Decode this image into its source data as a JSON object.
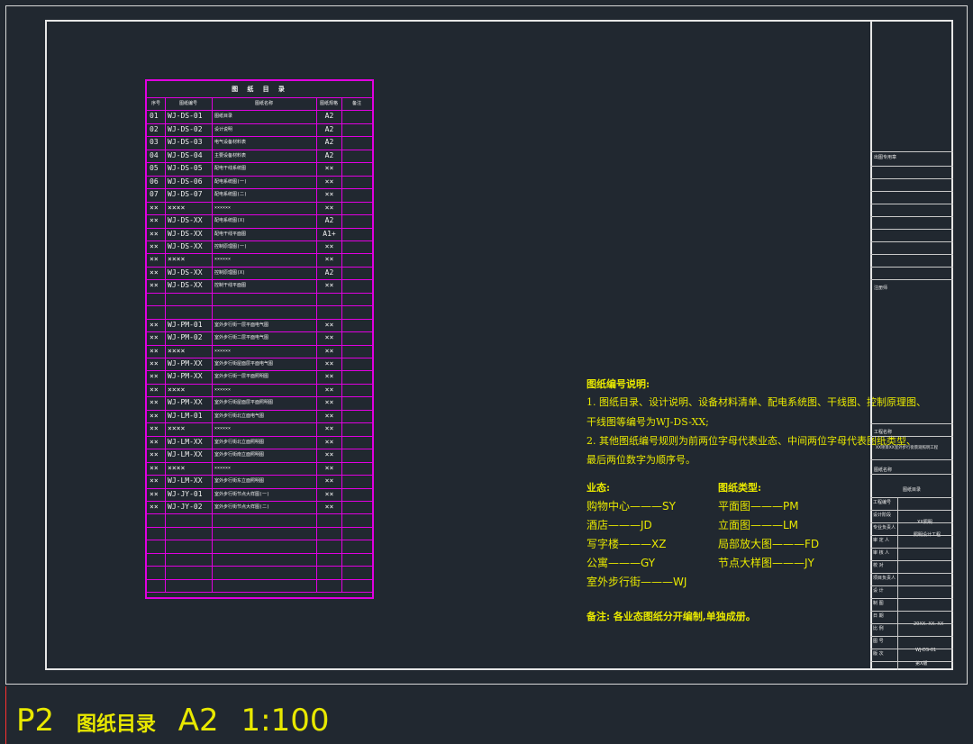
{
  "colors": {
    "background": "#212830",
    "table_border": "#e000e0",
    "note_text": "#e8e800",
    "frame": "#e6e6e6"
  },
  "table": {
    "title": "图 纸 目 录",
    "headers": [
      "序号",
      "图纸编号",
      "图纸名称",
      "图纸规格",
      "备注"
    ],
    "rows": [
      [
        "01",
        "WJ-DS-01",
        "图纸目录",
        "A2",
        ""
      ],
      [
        "02",
        "WJ-DS-02",
        "设计说明",
        "A2",
        ""
      ],
      [
        "03",
        "WJ-DS-03",
        "电气设备材料表",
        "A2",
        ""
      ],
      [
        "04",
        "WJ-DS-04",
        "主要设备材料表",
        "A2",
        ""
      ],
      [
        "05",
        "WJ-DS-05",
        "配电干线系统图",
        "××",
        ""
      ],
      [
        "06",
        "WJ-DS-06",
        "配电系统图(一)",
        "××",
        ""
      ],
      [
        "07",
        "WJ-DS-07",
        "配电系统图(二)",
        "××",
        ""
      ],
      [
        "××",
        "××××",
        "××××××",
        "××",
        ""
      ],
      [
        "××",
        "WJ-DS-XX",
        "配电系统图(X)",
        "A2",
        ""
      ],
      [
        "××",
        "WJ-DS-XX",
        "配电干线平面图",
        "A1+",
        ""
      ],
      [
        "××",
        "WJ-DS-XX",
        "控制原理图(一)",
        "××",
        ""
      ],
      [
        "××",
        "××××",
        "××××××",
        "××",
        ""
      ],
      [
        "××",
        "WJ-DS-XX",
        "控制原理图(X)",
        "A2",
        ""
      ],
      [
        "××",
        "WJ-DS-XX",
        "控制干线平面图",
        "××",
        ""
      ],
      [
        "",
        "",
        "",
        "",
        ""
      ],
      [
        "",
        "",
        "",
        "",
        ""
      ],
      [
        "××",
        "WJ-PM-01",
        "室外步行街一层平面电气图",
        "××",
        ""
      ],
      [
        "××",
        "WJ-PM-02",
        "室外步行街二层平面电气图",
        "××",
        ""
      ],
      [
        "××",
        "××××",
        "××××××",
        "××",
        ""
      ],
      [
        "××",
        "WJ-PM-XX",
        "室外步行街屋面层平面电气图",
        "××",
        ""
      ],
      [
        "××",
        "WJ-PM-XX",
        "室外步行街一层平面照明图",
        "××",
        ""
      ],
      [
        "××",
        "××××",
        "××××××",
        "××",
        ""
      ],
      [
        "××",
        "WJ-PM-XX",
        "室外步行街屋面层平面照明图",
        "××",
        ""
      ],
      [
        "××",
        "WJ-LM-01",
        "室外步行街北立面电气图",
        "××",
        ""
      ],
      [
        "××",
        "××××",
        "××××××",
        "××",
        ""
      ],
      [
        "××",
        "WJ-LM-XX",
        "室外步行街北立面照明图",
        "××",
        ""
      ],
      [
        "××",
        "WJ-LM-XX",
        "室外步行街南立面照明图",
        "××",
        ""
      ],
      [
        "××",
        "××××",
        "××××××",
        "××",
        ""
      ],
      [
        "××",
        "WJ-LM-XX",
        "室外步行街东立面照明图",
        "××",
        ""
      ],
      [
        "××",
        "WJ-JY-01",
        "室外步行街节点大样图(一)",
        "××",
        ""
      ],
      [
        "××",
        "WJ-JY-02",
        "室外步行街节点大样图(二)",
        "××",
        ""
      ],
      [
        "",
        "",
        "",
        "",
        ""
      ],
      [
        "",
        "",
        "",
        "",
        ""
      ],
      [
        "",
        "",
        "",
        "",
        ""
      ],
      [
        "",
        "",
        "",
        "",
        ""
      ],
      [
        "",
        "",
        "",
        "",
        ""
      ],
      [
        "",
        "",
        "",
        "",
        ""
      ]
    ]
  },
  "notes": {
    "heading": "图纸编号说明:",
    "line1": "1. 图纸目录、设计说明、设备材料清单、配电系统图、干线图、控制原理图、",
    "line2": "干线图等编号为WJ-DS-XX;",
    "line3": "2. 其他图纸编号规则为前两位字母代表业态、中间两位字母代表图纸类型、",
    "line4": "最后两位数字为顺序号。",
    "biz_heading": "业态:",
    "biz": [
      "购物中心———SY",
      "酒店———JD",
      "写字楼———XZ",
      "公寓———GY",
      "室外步行街———WJ"
    ],
    "type_heading": "图纸类型:",
    "types": [
      "平面图———PM",
      "立面图———LM",
      "局部放大图———FD",
      "节点大样图———JY"
    ],
    "remark": "备注: 各业态图纸分开编制,单独成册。"
  },
  "title_block": {
    "stamp_label": "出图专用章",
    "design_label": "注册师",
    "project_label": "工程名称",
    "project_name": "XX项目XX室外步行街景观照明工程",
    "drawing_no_label": "图纸名称",
    "drawing_name": "图纸目录",
    "company": "XX照明",
    "company2": "照明设计工程",
    "rows": [
      "工程编号",
      "设计阶段",
      "专业负责人",
      "审 定 人",
      "审 核 人",
      "校 对",
      "项目负责人",
      "设 计",
      "制 图",
      "日 期",
      "比 例",
      "图 号",
      "版 次"
    ],
    "date": "20XX. XX. XX",
    "drawing_number": "WJ-DS-01",
    "version": "第X版"
  },
  "footer": {
    "sheet": "P2",
    "name": "图纸目录",
    "size": "A2",
    "scale": "1:100"
  }
}
